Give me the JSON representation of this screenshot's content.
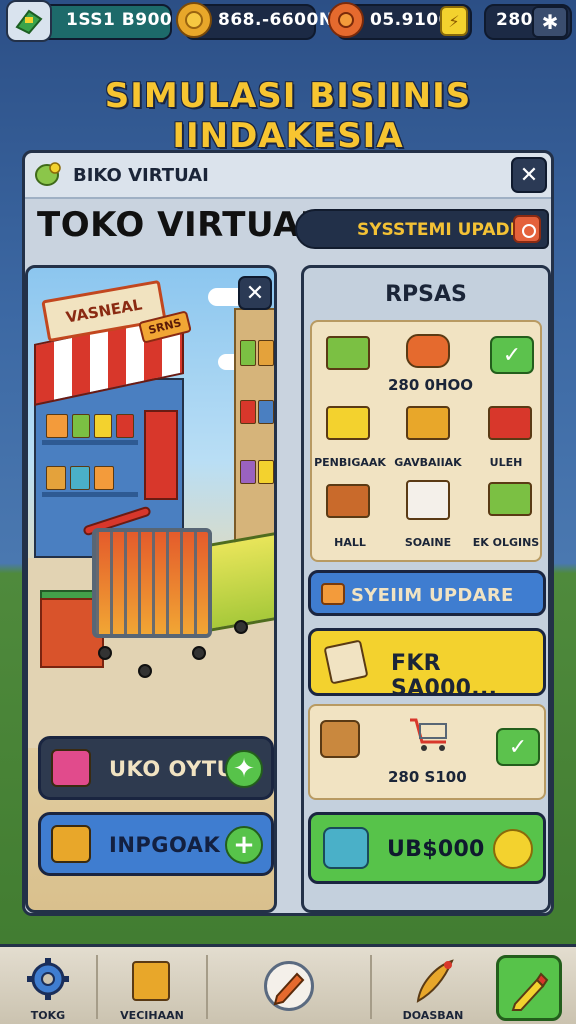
{
  "resources": {
    "cash": "1SS1 B900",
    "coins": "868.-6600N",
    "tokens": "05.9100",
    "level": "280"
  },
  "title": "SIMULASI BISIINIS IINDAKESIA",
  "panel": {
    "header_label": "BIKO VIRTUAI",
    "shop_title": "TOKO VIRTUAL",
    "system_pill": "SYSSTEMI UPADB",
    "shop_sign": "VASNEAL",
    "shop_sign_small": "SRNS",
    "scene_buttons": [
      {
        "label": "UKO OYTUM"
      },
      {
        "label": "INPGOAK"
      }
    ],
    "right": {
      "title": "RPSAS",
      "price_1": "280 0HOO",
      "items": [
        "PENBIGAAK",
        "GAVBAIIAK",
        "ULEH",
        "HALL",
        "SOAINE",
        "EK OLGINS"
      ],
      "system_update": "SYEIIM UPDARE",
      "offer": "FKR SA000...",
      "price_2": "280 S100",
      "currency": "UB$000"
    }
  },
  "nav": {
    "items": [
      {
        "label": "TOKG",
        "icon": "gear-icon"
      },
      {
        "label": "VECIHAAN",
        "icon": "box-icon"
      },
      {
        "label": "",
        "icon": "pencil-badge-icon"
      },
      {
        "label": "DOASBAN",
        "icon": "quill-icon"
      },
      {
        "label": "",
        "icon": "edit-icon"
      }
    ]
  },
  "colors": {
    "title_yellow": "#f7c531",
    "accent_green": "#57c34a",
    "accent_blue": "#3f7dd0",
    "accent_yellow": "#f3d22e",
    "dark_navy": "#1c2a45"
  }
}
